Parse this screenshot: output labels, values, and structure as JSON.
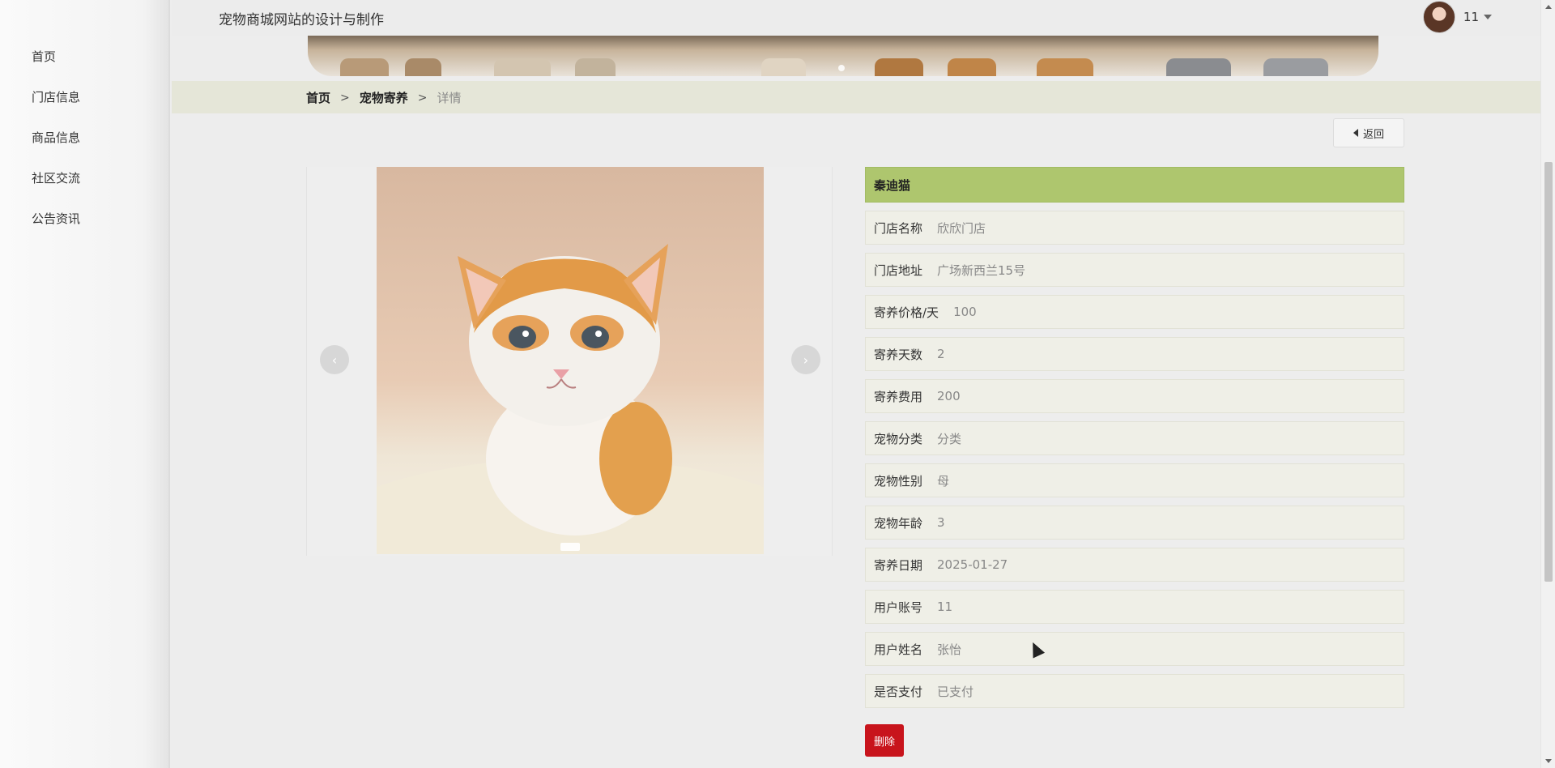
{
  "sidebar": {
    "items": [
      {
        "label": "首页"
      },
      {
        "label": "门店信息"
      },
      {
        "label": "商品信息"
      },
      {
        "label": "社区交流"
      },
      {
        "label": "公告资讯"
      }
    ]
  },
  "header": {
    "site_title": "宠物商城网站的设计与制作",
    "user_name": "11",
    "avatar_icon": "avatar-photo",
    "dropdown_icon": "caret-down-icon"
  },
  "breadcrumb": {
    "home": "首页",
    "separator": ">",
    "section": "宠物寄养",
    "current": "详情"
  },
  "back_button": {
    "label": "返回",
    "icon": "caret-left-icon"
  },
  "detail": {
    "title": "秦迪猫",
    "rows": [
      {
        "label": "门店名称",
        "value": "欣欣门店"
      },
      {
        "label": "门店地址",
        "value": "广场新西兰15号"
      },
      {
        "label": "寄养价格/天",
        "value": "100"
      },
      {
        "label": "寄养天数",
        "value": "2"
      },
      {
        "label": "寄养费用",
        "value": "200"
      },
      {
        "label": "宠物分类",
        "value": "分类"
      },
      {
        "label": "宠物性别",
        "value": "母"
      },
      {
        "label": "宠物年龄",
        "value": "3"
      },
      {
        "label": "寄养日期",
        "value": "2025-01-27"
      },
      {
        "label": "用户账号",
        "value": "11"
      },
      {
        "label": "用户姓名",
        "value": "张怡"
      },
      {
        "label": "是否支付",
        "value": "已支付"
      }
    ],
    "delete_label": "删除"
  },
  "gallery": {
    "prev_icon": "chevron-left-icon",
    "next_icon": "chevron-right-icon"
  },
  "colors": {
    "title_bar": "#aec66e",
    "delete_button": "#c8141c",
    "breadcrumb_bar": "#e5e6d8"
  }
}
